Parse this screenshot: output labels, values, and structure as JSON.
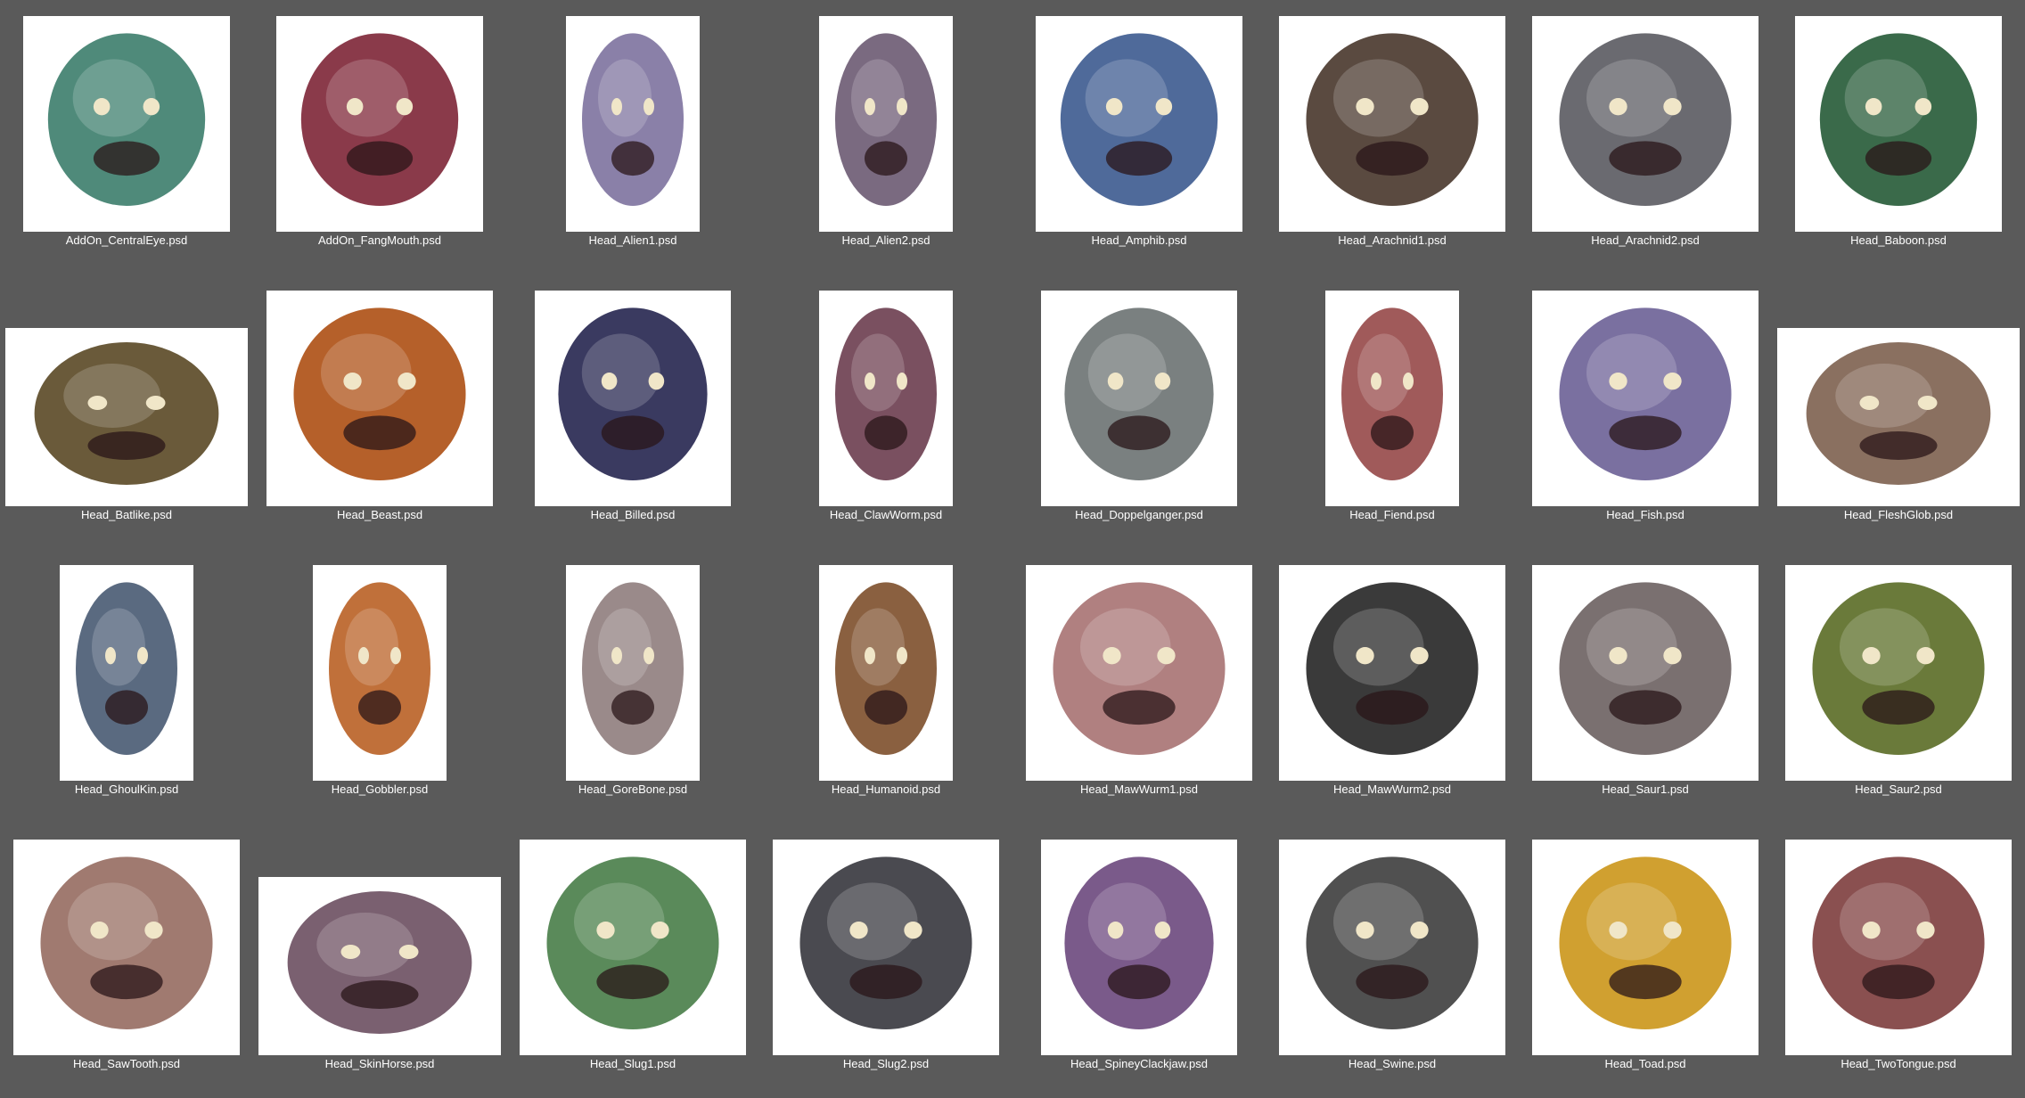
{
  "files": [
    {
      "name": "AddOn_CentralEye.psd",
      "icon": "eye-creature-icon",
      "shape": "sq",
      "color": "#4f8a7a"
    },
    {
      "name": "AddOn_FangMouth.psd",
      "icon": "fanged-mouth-icon",
      "shape": "sq",
      "color": "#8a3a4a"
    },
    {
      "name": "Head_Alien1.psd",
      "icon": "alien-head-icon",
      "shape": "por",
      "color": "#8a80a8"
    },
    {
      "name": "Head_Alien2.psd",
      "icon": "alien-head-icon",
      "shape": "por",
      "color": "#7a6a80"
    },
    {
      "name": "Head_Amphib.psd",
      "icon": "amphibian-head-icon",
      "shape": "sq",
      "color": "#4f6a9a"
    },
    {
      "name": "Head_Arachnid1.psd",
      "icon": "spider-head-icon",
      "shape": "lg",
      "color": "#5a4a40"
    },
    {
      "name": "Head_Arachnid2.psd",
      "icon": "spider-head-icon",
      "shape": "lg",
      "color": "#6a6a70"
    },
    {
      "name": "Head_Baboon.psd",
      "icon": "baboon-head-icon",
      "shape": "sq",
      "color": "#3a6a4a"
    },
    {
      "name": "Head_Batlike.psd",
      "icon": "bat-head-icon",
      "shape": "wide",
      "color": "#6a5a3a"
    },
    {
      "name": "Head_Beast.psd",
      "icon": "beast-head-icon",
      "shape": "lg",
      "color": "#b5602a"
    },
    {
      "name": "Head_Billed.psd",
      "icon": "bird-head-icon",
      "shape": "mid",
      "color": "#3a3a60"
    },
    {
      "name": "Head_ClawWorm.psd",
      "icon": "worm-head-icon",
      "shape": "por",
      "color": "#7a5060"
    },
    {
      "name": "Head_Doppelganger.psd",
      "icon": "doppelganger-head-icon",
      "shape": "mid",
      "color": "#7a8080"
    },
    {
      "name": "Head_Fiend.psd",
      "icon": "fiend-head-icon",
      "shape": "por",
      "color": "#a05a5a"
    },
    {
      "name": "Head_Fish.psd",
      "icon": "fish-head-icon",
      "shape": "lg",
      "color": "#7a70a0"
    },
    {
      "name": "Head_FleshGlob.psd",
      "icon": "flesh-glob-icon",
      "shape": "wide",
      "color": "#8a7060"
    },
    {
      "name": "Head_GhoulKin.psd",
      "icon": "ghoul-head-icon",
      "shape": "por",
      "color": "#5a6a80"
    },
    {
      "name": "Head_Gobbler.psd",
      "icon": "gobbler-head-icon",
      "shape": "por",
      "color": "#c0703a"
    },
    {
      "name": "Head_GoreBone.psd",
      "icon": "skull-head-icon",
      "shape": "por",
      "color": "#9a8a8a"
    },
    {
      "name": "Head_Humanoid.psd",
      "icon": "humanoid-head-icon",
      "shape": "por",
      "color": "#8a6040"
    },
    {
      "name": "Head_MawWurm1.psd",
      "icon": "maw-worm-head-icon",
      "shape": "lg",
      "color": "#b08080"
    },
    {
      "name": "Head_MawWurm2.psd",
      "icon": "maw-worm-head-icon",
      "shape": "lg",
      "color": "#3a3a3a"
    },
    {
      "name": "Head_Saur1.psd",
      "icon": "reptile-head-icon",
      "shape": "lg",
      "color": "#7a7070"
    },
    {
      "name": "Head_Saur2.psd",
      "icon": "reptile-head-icon",
      "shape": "lg",
      "color": "#6a7a3a"
    },
    {
      "name": "Head_SawTooth.psd",
      "icon": "sawtooth-head-icon",
      "shape": "lg",
      "color": "#a07a70"
    },
    {
      "name": "Head_SkinHorse.psd",
      "icon": "skinhorse-head-icon",
      "shape": "wide",
      "color": "#7a6070"
    },
    {
      "name": "Head_Slug1.psd",
      "icon": "slug-head-icon",
      "shape": "lg",
      "color": "#5a8a5a"
    },
    {
      "name": "Head_Slug2.psd",
      "icon": "slug-head-icon",
      "shape": "lg",
      "color": "#4a4a50"
    },
    {
      "name": "Head_SpineyClackjaw.psd",
      "icon": "spiny-head-icon",
      "shape": "mid",
      "color": "#7a5a8a"
    },
    {
      "name": "Head_Swine.psd",
      "icon": "swine-head-icon",
      "shape": "lg",
      "color": "#505050"
    },
    {
      "name": "Head_Toad.psd",
      "icon": "toad-head-icon",
      "shape": "lg",
      "color": "#d0a030"
    },
    {
      "name": "Head_TwoTongue.psd",
      "icon": "two-tongue-head-icon",
      "shape": "lg",
      "color": "#8a5050"
    }
  ]
}
